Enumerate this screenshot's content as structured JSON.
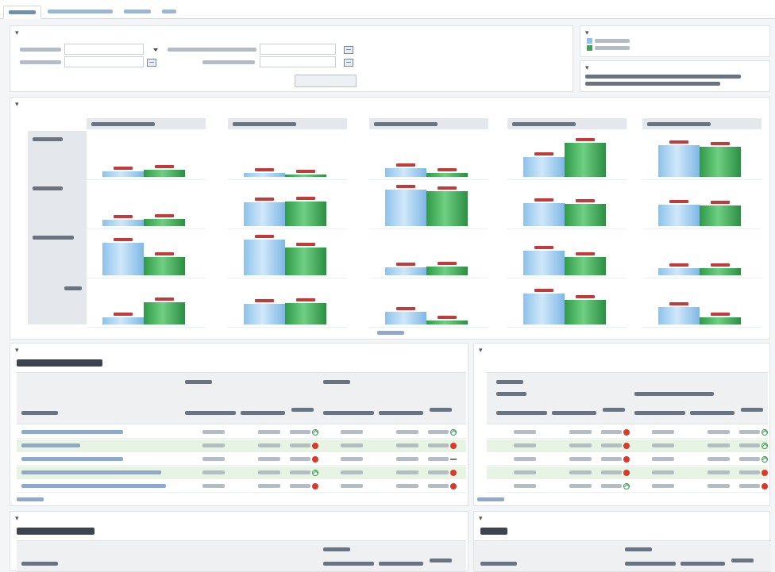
{
  "colors": {
    "accent": "#6f8fb2",
    "link": "#3f6cab",
    "header_gray": "#e4e7eb",
    "bar_previous": "#8dc2ea",
    "bar_current": "#3aa653",
    "increase_indicator": "#3a9b4c",
    "decrease_indicator": "#d93a2b",
    "highlight_row": "#e7f4e4"
  },
  "icons": {
    "calendar": "calendar-icon",
    "dropdown": "chevron-down-icon",
    "collapse": "collapse-triangle-icon",
    "increase": "arrow-up-circle-icon",
    "decrease": "red-circle-icon",
    "no_change": "dash-icon"
  },
  "legend": {
    "series": [
      {
        "color": "#8dc2ea"
      },
      {
        "color": "#3aa653"
      }
    ]
  },
  "chart_data": {
    "type": "bar",
    "panels": [
      {
        "rows": [
          {
            "prev": 0.14,
            "cur": 0.18
          },
          {
            "prev": 0.16,
            "cur": 0.18
          },
          {
            "prev": 0.82,
            "cur": 0.45
          },
          {
            "prev": 0.18,
            "cur": 0.55
          }
        ]
      },
      {
        "rows": [
          {
            "prev": 0.1,
            "cur": 0.06
          },
          {
            "prev": 0.6,
            "cur": 0.62
          },
          {
            "prev": 0.9,
            "cur": 0.7
          },
          {
            "prev": 0.52,
            "cur": 0.54
          }
        ]
      },
      {
        "rows": [
          {
            "prev": 0.22,
            "cur": 0.1
          },
          {
            "prev": 0.92,
            "cur": 0.88
          },
          {
            "prev": 0.2,
            "cur": 0.22
          },
          {
            "prev": 0.32,
            "cur": 0.1
          }
        ]
      },
      {
        "rows": [
          {
            "prev": 0.5,
            "cur": 0.85
          },
          {
            "prev": 0.58,
            "cur": 0.55
          },
          {
            "prev": 0.62,
            "cur": 0.45
          },
          {
            "prev": 0.78,
            "cur": 0.62
          }
        ]
      },
      {
        "rows": [
          {
            "prev": 0.8,
            "cur": 0.76
          },
          {
            "prev": 0.54,
            "cur": 0.52
          },
          {
            "prev": 0.18,
            "cur": 0.18
          },
          {
            "prev": 0.44,
            "cur": 0.18
          }
        ]
      }
    ]
  },
  "main_table": {
    "rows": [
      {
        "indicators": [
          "up",
          "up"
        ]
      },
      {
        "indicators": [
          "down",
          "down"
        ]
      },
      {
        "indicators": [
          "down",
          "flat"
        ]
      },
      {
        "indicators": [
          "up",
          "down"
        ]
      },
      {
        "indicators": [
          "down",
          "down"
        ]
      }
    ]
  },
  "side_table": {
    "rows": [
      {
        "indicators": [
          "down",
          "up"
        ]
      },
      {
        "indicators": [
          "down",
          "up"
        ]
      },
      {
        "indicators": [
          "down",
          "up"
        ]
      },
      {
        "indicators": [
          "down",
          "down"
        ]
      },
      {
        "indicators": [
          "up",
          "down"
        ]
      }
    ]
  }
}
